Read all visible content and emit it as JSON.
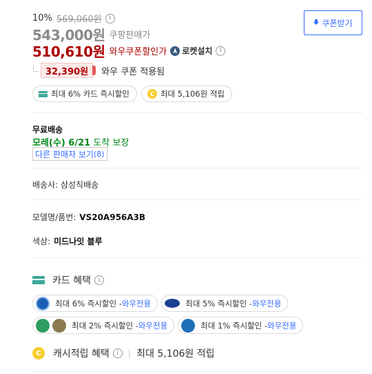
{
  "price": {
    "discount_rate": "10%",
    "original_price": "569,060원",
    "sale_price": "543,000원",
    "sale_label": "쿠팡판매가",
    "wow_price": "510,610원",
    "wow_label": "와우쿠폰할인가",
    "rocket_label": "로켓설치"
  },
  "coupon_button": {
    "label": "쿠폰받기"
  },
  "coupon": {
    "amount": "32,390원",
    "text": "와우 쿠폰 적용됨"
  },
  "benefit_pills": [
    {
      "label": "최대 6% 카드 즉시할인",
      "icon": "card-icon"
    },
    {
      "label": "최대 5,106원 적립",
      "icon": "coin-icon",
      "coin_letter": "C"
    }
  ],
  "shipping": {
    "title": "무료배송",
    "date_strong": "모레(수) 6/21",
    "date_rest": " 도착 보장",
    "other_sellers": "다른 판매자 보기",
    "other_sellers_count": "(8)"
  },
  "seller_line": "배송사: 삼성직배송",
  "model_label": "모델명/품번:",
  "model_value": "VS20A956A3B",
  "color_label": "색상:",
  "color_value": "미드나잇 블루",
  "card_benefits": {
    "title": "카드 혜택",
    "items": [
      {
        "text": "최대 6% 즉시할인 - ",
        "wow": "와우전용",
        "bank": "shinhan"
      },
      {
        "text": "최대 5% 즉시할인 - ",
        "wow": "와우전용",
        "bank": "samsung"
      },
      {
        "text": "최대 2% 즉시할인 - ",
        "wow": "와우전용",
        "bank": "nh-kb"
      },
      {
        "text": "최대 1% 즉시할인 - ",
        "wow": "와우전용",
        "bank": "woori"
      }
    ]
  },
  "cash": {
    "title": "캐시적립 혜택",
    "divider": "|",
    "amount_text": "최대 5,106원 적립",
    "coin_letter": "C"
  },
  "colors": {
    "wow_red": "#ae0000",
    "link_blue": "#346aff",
    "ship_green": "#00891a",
    "card_teal": "#3fa79a",
    "coin_yellow": "#f7cd2f"
  }
}
